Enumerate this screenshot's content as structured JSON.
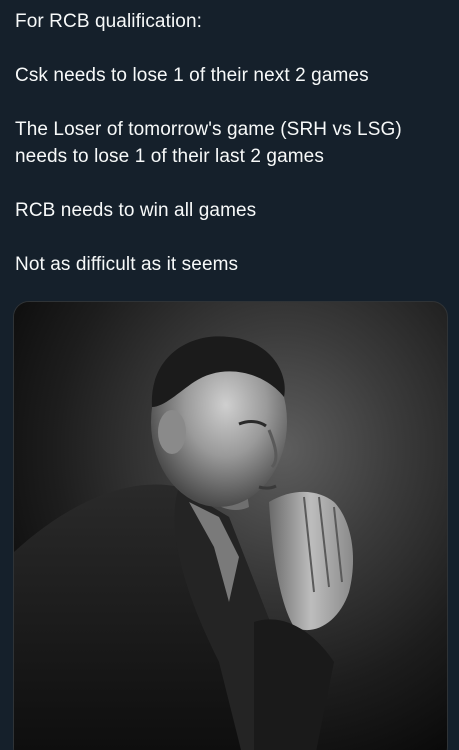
{
  "tweet": {
    "lines": [
      "For RCB qualification:",
      "Csk needs to lose 1 of their next 2 games",
      "The Loser of tomorrow's game (SRH vs LSG) needs to lose 1 of their last 2 games",
      "RCB needs to win all games",
      "Not as difficult as it seems"
    ]
  },
  "media": {
    "type": "photo",
    "style": "black-and-white portrait, man with hands pressed together thoughtfully",
    "colors": {
      "background": "#15202b",
      "text": "#f7f9f9"
    }
  }
}
